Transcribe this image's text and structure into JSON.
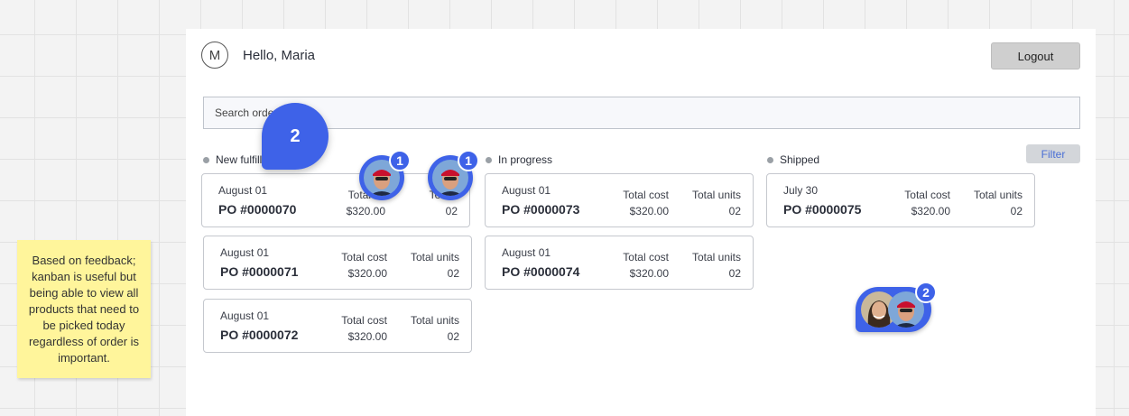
{
  "header": {
    "avatar_initial": "M",
    "greeting": "Hello, Maria",
    "logout_label": "Logout"
  },
  "search": {
    "text": "Search orde"
  },
  "filter_label": "Filter",
  "columns": [
    {
      "title": "New fulfillm",
      "cards": [
        {
          "date": "August 01",
          "po": "PO #0000070",
          "cost_label": "Total co",
          "cost": "$320.00",
          "units_label": "Totals",
          "units": "02"
        },
        {
          "date": "August 01",
          "po": "PO #0000071",
          "cost_label": "Total cost",
          "cost": "$320.00",
          "units_label": "Total units",
          "units": "02"
        },
        {
          "date": "August 01",
          "po": "PO #0000072",
          "cost_label": "Total cost",
          "cost": "$320.00",
          "units_label": "Total units",
          "units": "02"
        }
      ]
    },
    {
      "title": "In progress",
      "cards": [
        {
          "date": "August 01",
          "po": "PO #0000073",
          "cost_label": "Total cost",
          "cost": "$320.00",
          "units_label": "Total units",
          "units": "02"
        },
        {
          "date": "August 01",
          "po": "PO #0000074",
          "cost_label": "Total cost",
          "cost": "$320.00",
          "units_label": "Total units",
          "units": "02"
        }
      ]
    },
    {
      "title": "Shipped",
      "cards": [
        {
          "date": "July 30",
          "po": "PO #0000075",
          "cost_label": "Total cost",
          "cost": "$320.00",
          "units_label": "Total units",
          "units": "02"
        }
      ]
    }
  ],
  "sticky_note": "Based on feedback; kanban is useful but being able to view all products that need to be picked today regardless of order is important.",
  "comment_bubbles": {
    "big_count": "2",
    "face1_count": "1",
    "face2_count": "1",
    "pair_count": "2"
  },
  "colors": {
    "accent": "#3e62e8",
    "sticky": "#fff59b",
    "filter_text": "#4a6fd6"
  }
}
